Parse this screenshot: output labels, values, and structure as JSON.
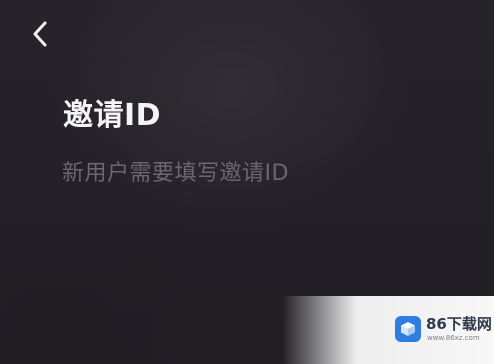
{
  "header": {
    "back_icon": "chevron-left-icon"
  },
  "main": {
    "title": "邀请ID",
    "subtitle": "新用户需要填写邀请ID"
  },
  "watermark": {
    "logo_icon": "cube-icon",
    "text": "86下载网",
    "sub": "www.86xz.com"
  },
  "colors": {
    "background": "#222025",
    "title": "#f4f3f5",
    "subtitle": "#6a676e",
    "watermark_accent": "#2f7de1"
  }
}
